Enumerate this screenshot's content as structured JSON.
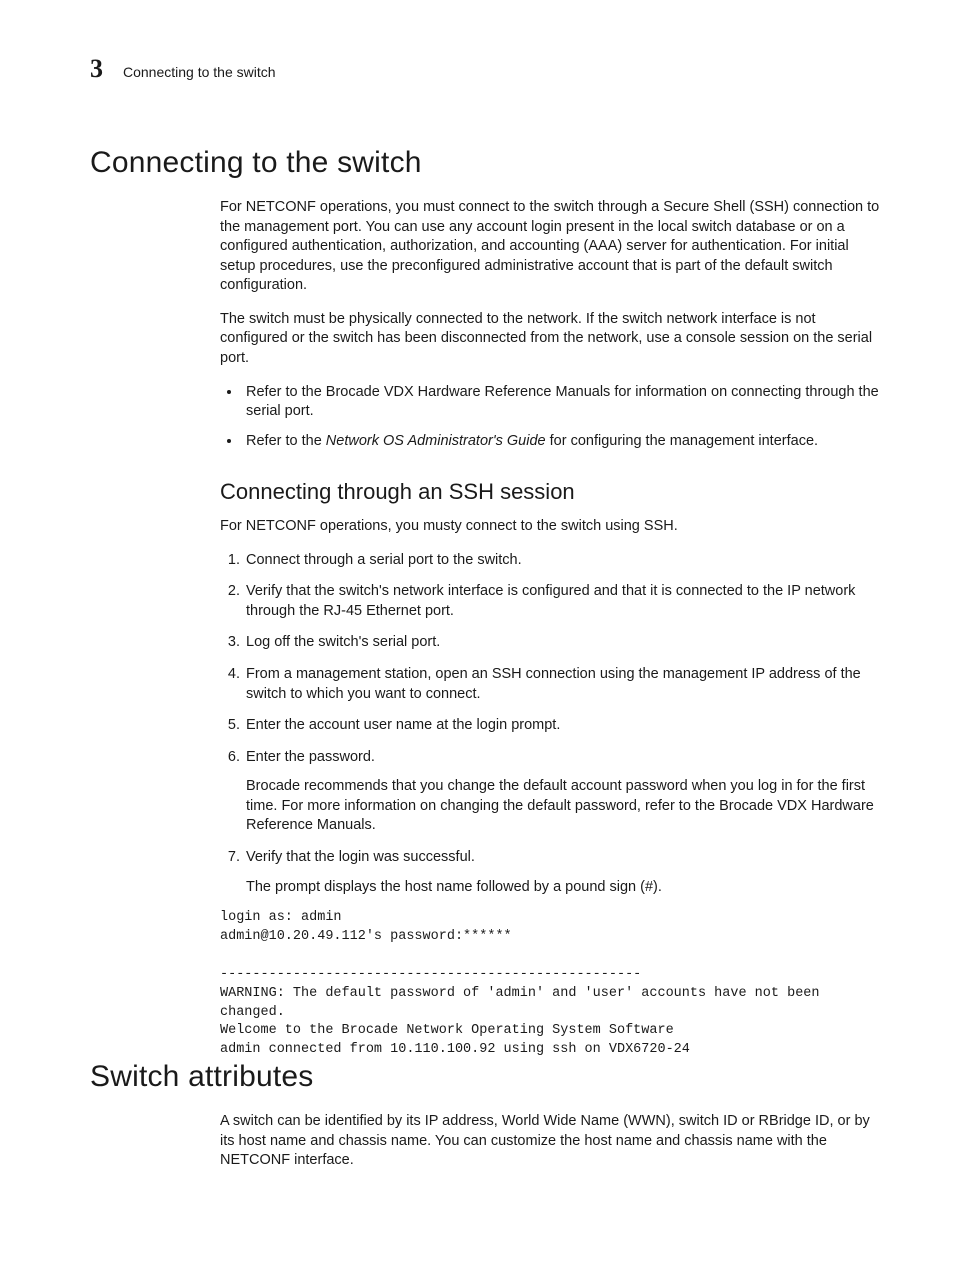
{
  "header": {
    "chapter_number": "3",
    "running_title": "Connecting to the switch"
  },
  "section1": {
    "title": "Connecting to the switch",
    "p1": "For NETCONF operations, you must connect to the switch through a Secure Shell (SSH) connection to the management port. You can use any account login present in the local switch database or on a configured authentication, authorization, and accounting (AAA) server for authentication. For initial setup procedures, use the preconfigured administrative account that is part of the default switch configuration.",
    "p2": "The switch must be physically connected to the network. If the switch network interface is not configured or the switch has been disconnected from the network, use a console session on the serial port.",
    "bullets": {
      "b1": "Refer to the Brocade VDX Hardware Reference Manuals for information on connecting through the serial port.",
      "b2_a": "Refer to the ",
      "b2_i": "Network OS Administrator's Guide",
      "b2_b": " for configuring the management interface."
    },
    "sub": {
      "title": "Connecting through an SSH session",
      "intro": "For NETCONF operations, you musty connect to the switch using SSH.",
      "steps": {
        "s1": "Connect through a serial port to the switch.",
        "s2": "Verify that the switch's network interface is configured and that it is connected to the IP network through the RJ-45 Ethernet port.",
        "s3": "Log off the switch's serial port.",
        "s4": "From a management station, open an SSH connection using the management IP address of the switch to which you want to connect.",
        "s5": "Enter the account user name at the login prompt.",
        "s6": "Enter the password.",
        "s6_sub": "Brocade recommends that you change the default account password when you log in for the first time. For more information on changing the default password, refer to the Brocade VDX Hardware Reference Manuals.",
        "s7": "Verify that the login was successful.",
        "s7_sub": "The prompt displays the host name followed by a pound sign (#)."
      },
      "terminal": "login as: admin\nadmin@10.20.49.112's password:******\n\n----------------------------------------------------\nWARNING: The default password of 'admin' and 'user' accounts have not been changed.\nWelcome to the Brocade Network Operating System Software\nadmin connected from 10.110.100.92 using ssh on VDX6720-24"
    }
  },
  "section2": {
    "title": "Switch attributes",
    "p1": "A switch can be identified by its IP address, World Wide Name (WWN), switch ID or RBridge ID, or by its host name and chassis name. You can customize the host name and chassis name with the NETCONF interface."
  }
}
